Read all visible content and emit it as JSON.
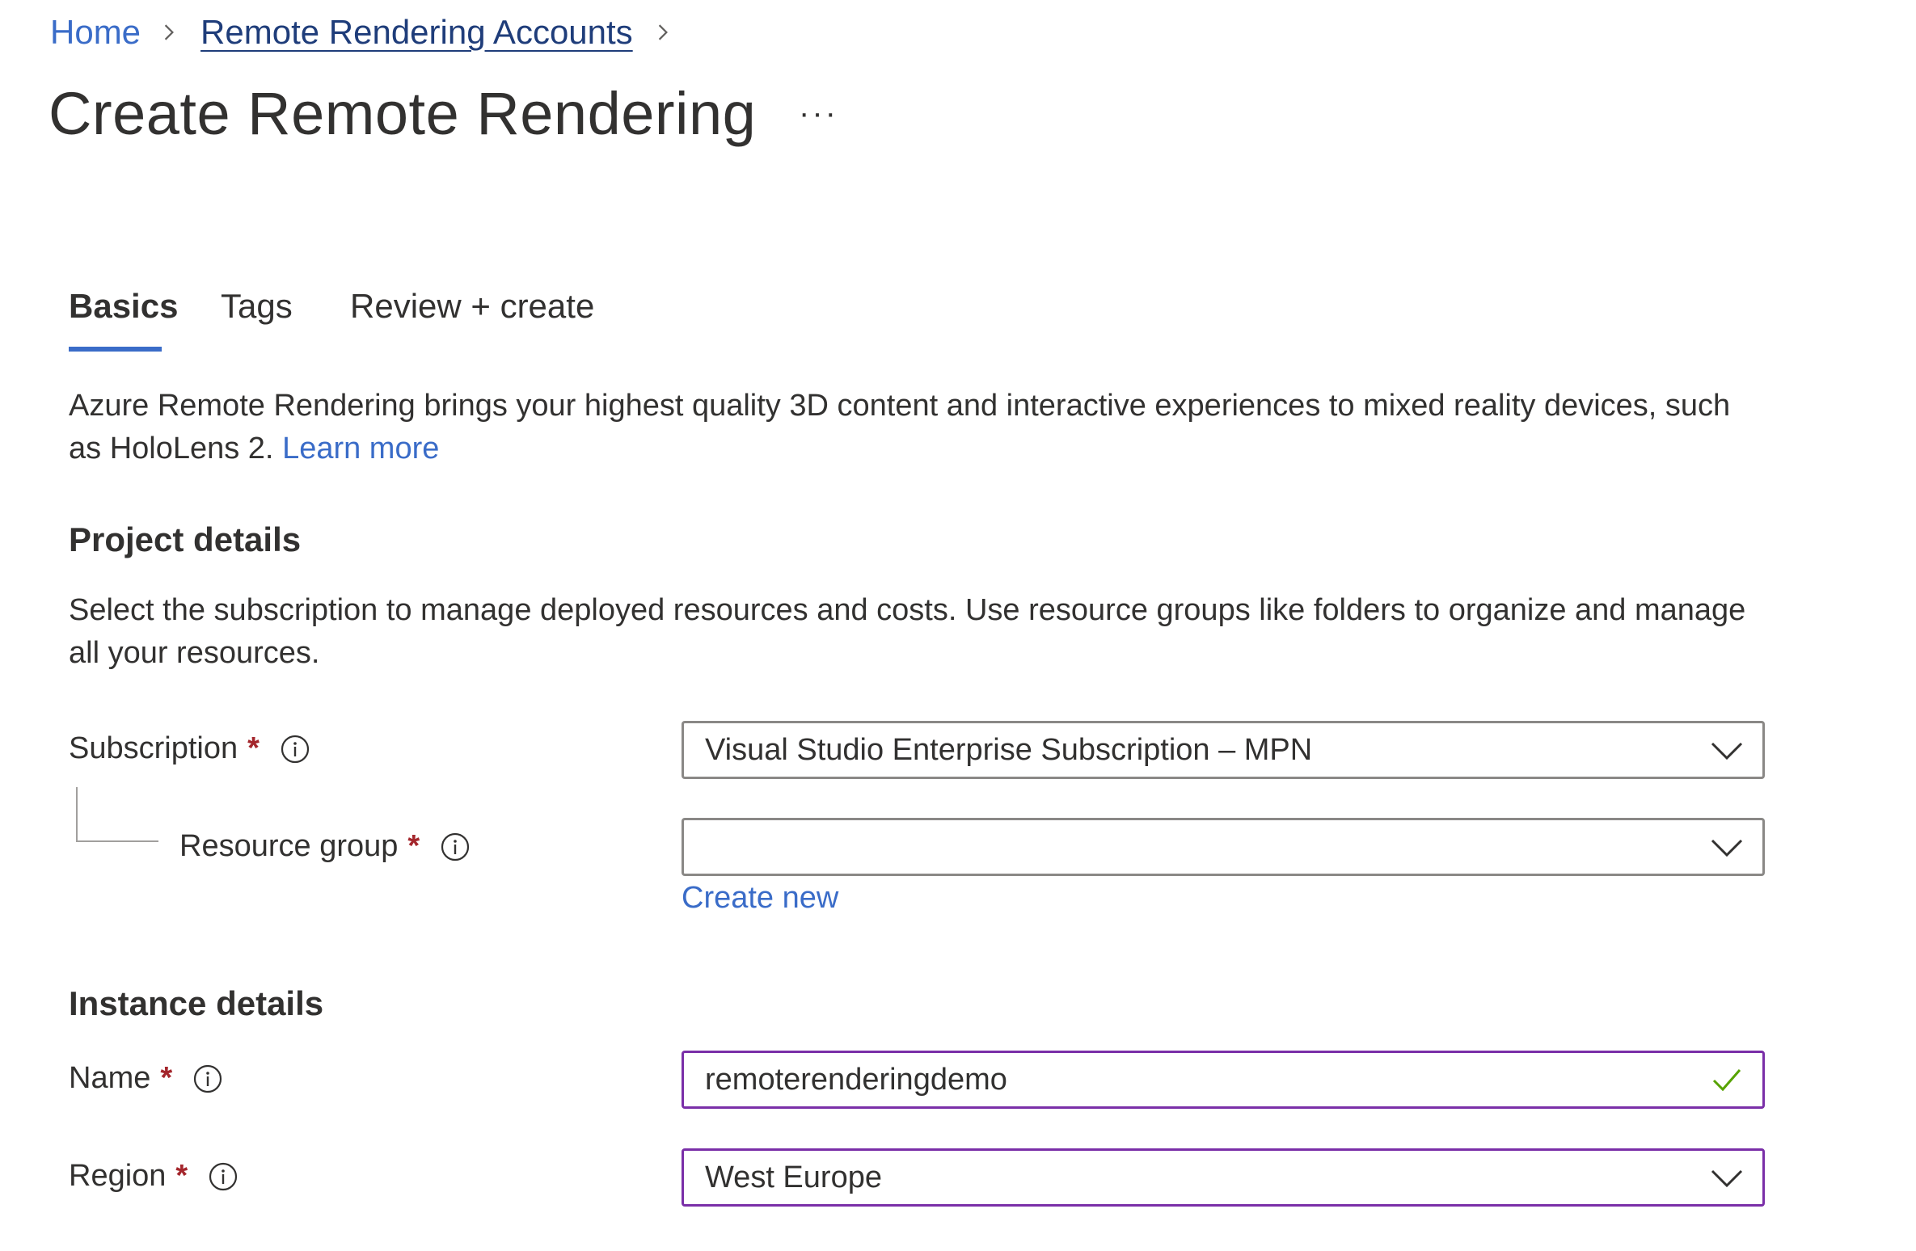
{
  "breadcrumb": {
    "home": "Home",
    "accounts": "Remote Rendering Accounts"
  },
  "page": {
    "title": "Create Remote Rendering",
    "more": "···"
  },
  "tabs": [
    {
      "label": "Basics",
      "active": true
    },
    {
      "label": "Tags",
      "active": false
    },
    {
      "label": "Review + create",
      "active": false
    }
  ],
  "intro": {
    "text": "Azure Remote Rendering brings your highest quality 3D content and interactive experiences to mixed reality devices, such as HoloLens 2.",
    "learn_more": "Learn more"
  },
  "project": {
    "heading": "Project details",
    "description": "Select the subscription to manage deployed resources and costs. Use resource groups like folders to organize and manage all your resources.",
    "subscription": {
      "label": "Subscription",
      "required": "*",
      "value": "Visual Studio Enterprise Subscription – MPN"
    },
    "resource_group": {
      "label": "Resource group",
      "required": "*",
      "value": "",
      "create_new": "Create new"
    }
  },
  "instance": {
    "heading": "Instance details",
    "name": {
      "label": "Name",
      "required": "*",
      "value": "remoterenderingdemo"
    },
    "region": {
      "label": "Region",
      "required": "*",
      "value": "West Europe"
    }
  },
  "colors": {
    "link": "#3a6cc8",
    "required": "#a4262c",
    "focus_border": "#7a2fa8",
    "valid_check": "#57a300"
  }
}
